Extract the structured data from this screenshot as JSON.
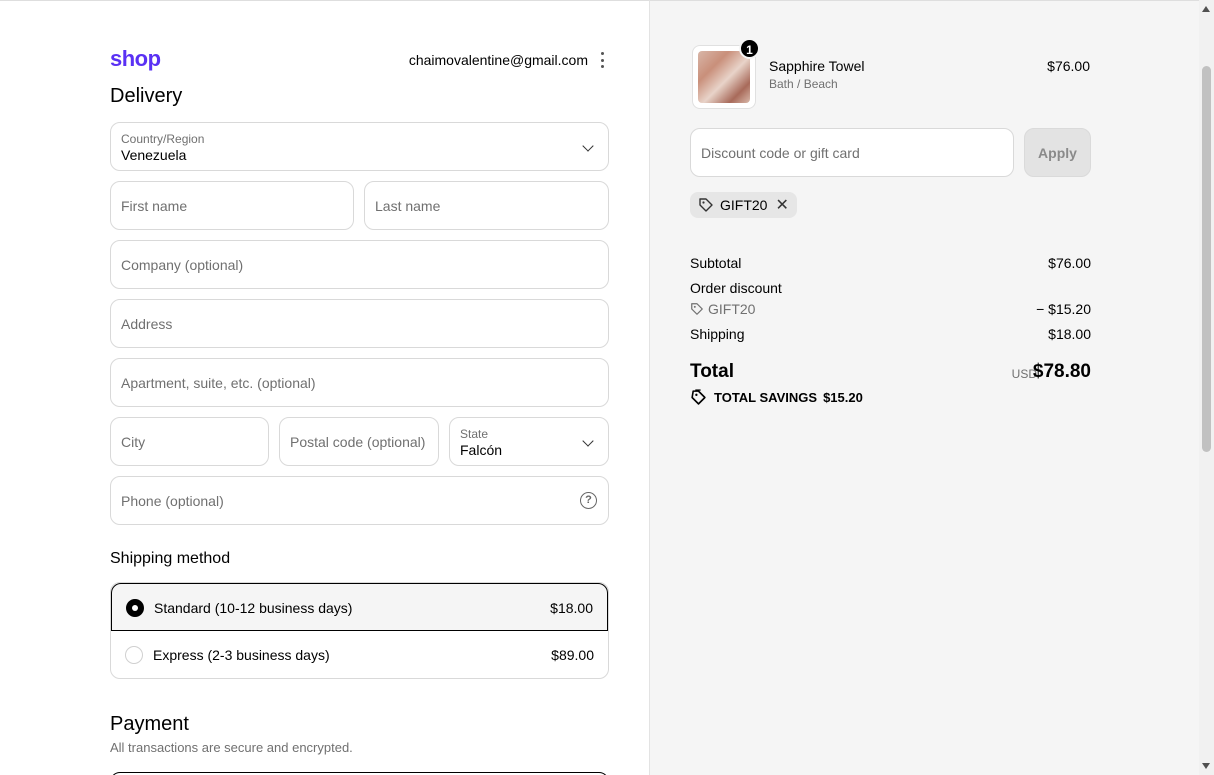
{
  "header": {
    "logo": "shop",
    "email": "chaimovalentine@gmail.com"
  },
  "delivery": {
    "title": "Delivery",
    "country": {
      "label": "Country/Region",
      "value": "Venezuela"
    },
    "first_name": {
      "placeholder": "First name"
    },
    "last_name": {
      "placeholder": "Last name"
    },
    "company": {
      "placeholder": "Company (optional)"
    },
    "address": {
      "placeholder": "Address"
    },
    "apartment": {
      "placeholder": "Apartment, suite, etc. (optional)"
    },
    "city": {
      "placeholder": "City"
    },
    "postal": {
      "placeholder": "Postal code (optional)"
    },
    "state": {
      "label": "State",
      "value": "Falcón"
    },
    "phone": {
      "placeholder": "Phone (optional)"
    }
  },
  "shipping": {
    "title": "Shipping method",
    "options": [
      {
        "name": "Standard (10-12 business days)",
        "price": "$18.00",
        "selected": true
      },
      {
        "name": "Express (2-3 business days)",
        "price": "$89.00",
        "selected": false
      }
    ]
  },
  "payment": {
    "title": "Payment",
    "subtitle": "All transactions are secure and encrypted."
  },
  "summary": {
    "product": {
      "name": "Sapphire Towel",
      "variant": "Bath / Beach",
      "price": "$76.00",
      "quantity": "1"
    },
    "discount": {
      "placeholder": "Discount code or gift card",
      "apply_label": "Apply",
      "applied_code": "GIFT20"
    },
    "subtotal": {
      "label": "Subtotal",
      "value": "$76.00"
    },
    "order_discount": {
      "label": "Order discount",
      "code": "GIFT20",
      "value": "− $15.20"
    },
    "shipping": {
      "label": "Shipping",
      "value": "$18.00"
    },
    "total": {
      "label": "Total",
      "currency": "USD",
      "value": "$78.80"
    },
    "savings": {
      "label": "TOTAL SAVINGS",
      "value": "$15.20"
    }
  },
  "colors": {
    "brand": "#5a31f4",
    "summary_bg": "#f5f5f5"
  }
}
